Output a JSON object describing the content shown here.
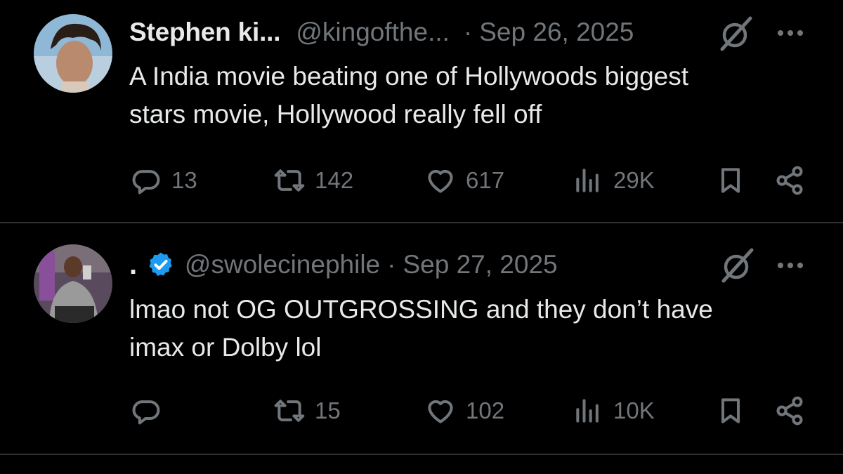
{
  "tweets": [
    {
      "display_name": "Stephen ki...",
      "handle": "@kingofthe...",
      "separator": "·",
      "date": "Sep 26, 2025",
      "verified": false,
      "text_lines": [
        "A India movie beating one of Hollywoods biggest",
        "stars movie, Hollywood really fell off"
      ],
      "replies": "13",
      "retweets": "142",
      "likes": "617",
      "views": "29K"
    },
    {
      "display_name": ".",
      "handle": "@swolecinephile",
      "separator": "·",
      "date": "Sep 27, 2025",
      "verified": true,
      "text_lines": [
        "lmao not OG OUTGROSSING and they don’t have",
        "imax or Dolby lol"
      ],
      "replies": "",
      "retweets": "15",
      "likes": "102",
      "views": "10K"
    }
  ],
  "colors": {
    "background": "#000000",
    "text_primary": "#e7e9ea",
    "text_secondary": "#71767b",
    "verified_blue": "#1d9bf0",
    "divider": "#2f3336"
  },
  "icons": [
    "grok-icon",
    "more-icon",
    "reply-icon",
    "retweet-icon",
    "like-icon",
    "views-icon",
    "bookmark-icon",
    "share-icon",
    "verified-icon"
  ]
}
